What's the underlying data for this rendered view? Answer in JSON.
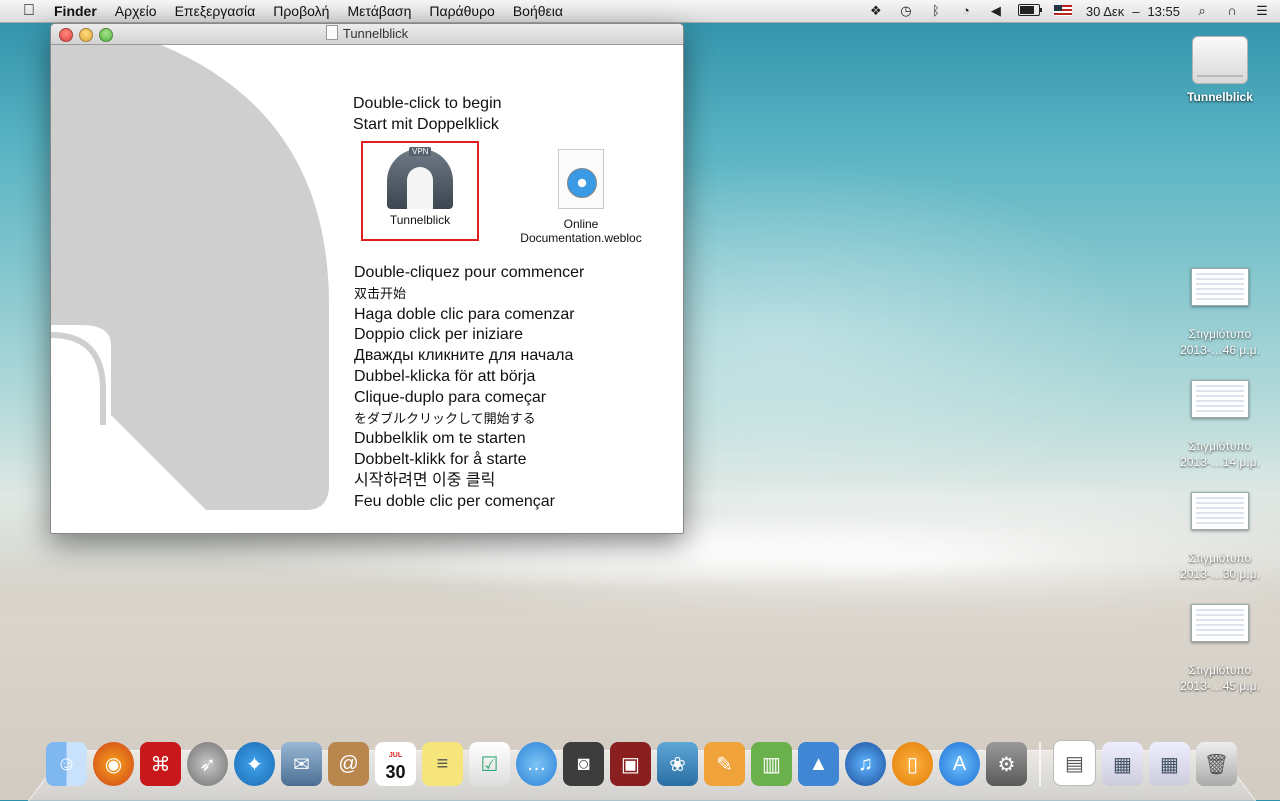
{
  "menubar": {
    "apple": "",
    "items": [
      "Finder",
      "Αρχείο",
      "Επεξεργασία",
      "Προβολή",
      "Μετάβαση",
      "Παράθυρο",
      "Βοήθεια"
    ],
    "date": "30 Δεκ",
    "time": "13:55"
  },
  "window": {
    "title": "Tunnelblick",
    "intro": [
      "Double-click to begin",
      "Start mit Doppelklick"
    ],
    "files": [
      {
        "label": "Tunnelblick",
        "badge": "VPN"
      },
      {
        "label": "Online Documentation.webloc"
      }
    ],
    "languages": [
      "Double-cliquez pour commencer",
      "双击开始",
      "Haga doble clic para comenzar",
      "Doppio click per iniziare",
      "Дважды кликните для начала",
      "Dubbel-klicka för att börja",
      "Clique-duplo para começar",
      "をダブルクリックして開始する",
      "Dubbelklik om te starten",
      "Dobbelt-klikk for å starte",
      "시작하려면 이중 클릭",
      "Feu doble clic per començar"
    ]
  },
  "desktop": {
    "drive": "Tunnelblick",
    "screenshots": [
      {
        "line1": "Στιγμιότυπο",
        "line2": "2013-…46 μ.μ."
      },
      {
        "line1": "Στιγμιότυπο",
        "line2": "2013-…14 μ.μ."
      },
      {
        "line1": "Στιγμιότυπο",
        "line2": "2013-…30 μ.μ."
      },
      {
        "line1": "Στιγμιότυπο",
        "line2": "2013-…45 μ.μ."
      }
    ]
  },
  "calendar_day": "30",
  "calendar_month": "JUL",
  "colors": {
    "highlight": "#e02020",
    "tunnel_shape": "#cfcfcf"
  }
}
